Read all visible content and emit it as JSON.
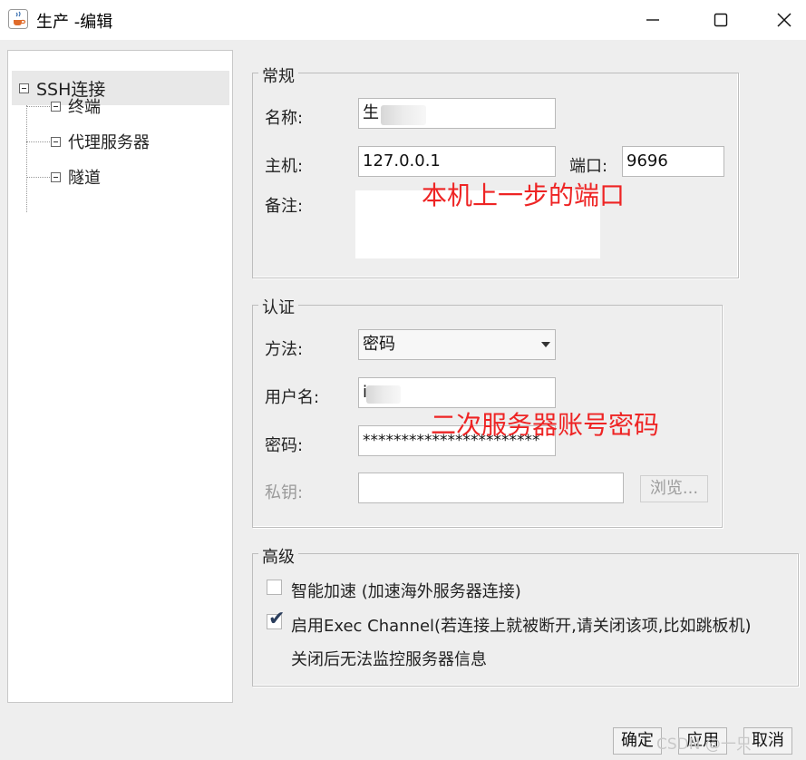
{
  "window": {
    "title": "生产 -编辑",
    "minimize_icon": "minimize-icon",
    "maximize_icon": "maximize-icon",
    "close_icon": "close-icon"
  },
  "tree": {
    "root": {
      "label": "SSH连接",
      "expanded": true
    },
    "children": [
      {
        "label": "终端"
      },
      {
        "label": "代理服务器"
      },
      {
        "label": "隧道"
      }
    ]
  },
  "general": {
    "title": "常规",
    "name_label": "名称:",
    "name_value": "生",
    "host_label": "主机:",
    "host_value": "127.0.0.1",
    "port_label": "端口:",
    "port_value": "9696",
    "note_label": "备注:",
    "note_value": ""
  },
  "auth": {
    "title": "认证",
    "method_label": "方法:",
    "method_value": "密码",
    "username_label": "用户名:",
    "username_value": "i",
    "password_label": "密码:",
    "password_value": "***********************",
    "private_key_label": "私钥:",
    "private_key_value": "",
    "browse_label": "浏览..."
  },
  "advanced": {
    "title": "高级",
    "smart_accel_label": "智能加速 (加速海外服务器连接)",
    "smart_accel_checked": false,
    "exec_channel_label": "启用Exec Channel(若连接上就被断开,请关闭该项,比如跳板机)",
    "exec_channel_checked": true,
    "exec_channel_note": "关闭后无法监控服务器信息"
  },
  "annotations": {
    "port_note": "本机上一步的端口",
    "account_note": "二次服务器账号密码"
  },
  "buttons": {
    "ok": "确定",
    "apply": "应用",
    "cancel": "取消"
  },
  "watermark": "CSDN @一只",
  "colors": {
    "annotation": "#ee2424",
    "tree_selected_bg": "#e8e8e8",
    "background": "#eeeeee"
  }
}
